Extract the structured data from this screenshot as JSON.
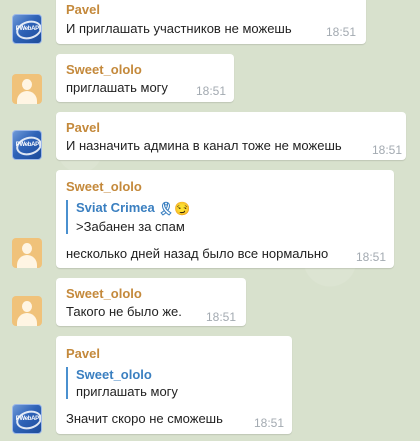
{
  "messages": [
    {
      "sender": "Pavel",
      "text": "И приглашать участников не можешь",
      "time": "18:51"
    },
    {
      "sender": "Sweet_ololo",
      "text": "приглашать могу",
      "time": "18:51"
    },
    {
      "sender": "Pavel",
      "text": "И назначить админа в канал тоже не можешь",
      "time": "18:51"
    },
    {
      "sender": "Sweet_ololo",
      "reply": {
        "name": "Sviat Crimea",
        "emoji": "🎗😏",
        "text": ">Забанен за спам"
      },
      "text": "несколько дней назад было все нормально",
      "time": "18:51"
    },
    {
      "sender": "Sweet_ololo",
      "text": "Такого не было же.",
      "time": "18:51"
    },
    {
      "sender": "Pavel",
      "reply": {
        "name": "Sweet_ololo",
        "text": "приглашать могу"
      },
      "text": "Значит скоро не сможешь",
      "time": "18:51"
    }
  ],
  "avatars": {
    "pavel_label": "PWebAPI"
  },
  "colors": {
    "sender_name": "#c4893b",
    "reply_name": "#3a7fc0",
    "reply_bar": "#4a90cf",
    "bubble": "#ffffff",
    "background": "#d8e1cd"
  }
}
